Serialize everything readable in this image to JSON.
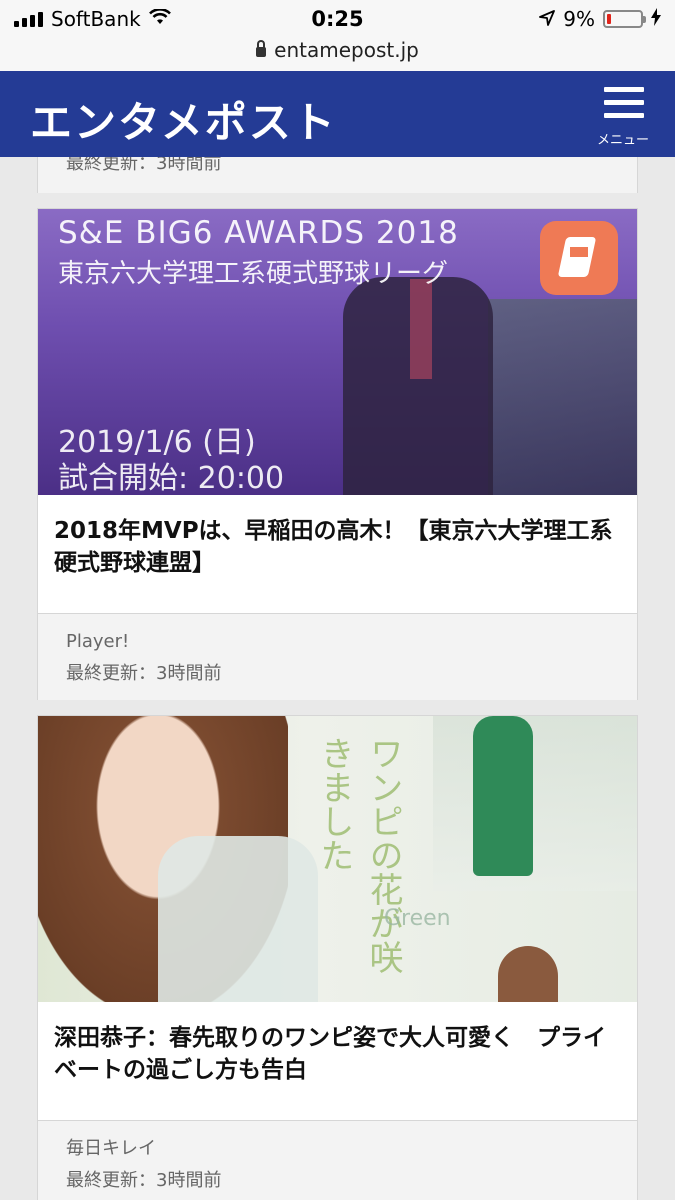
{
  "status_bar": {
    "carrier": "SoftBank",
    "time": "0:25",
    "battery": "9%",
    "battery_level": 0.09
  },
  "browser": {
    "url": "entamepost.jp"
  },
  "header": {
    "logo": "エンタメポスト",
    "menu_label": "メニュー"
  },
  "articles": [
    {
      "meta_updated": "最終更新：3時間前"
    },
    {
      "image_text": {
        "line1": "S&E BIG6 AWARDS 2018",
        "line2": "東京六大学理工系硬式野球リーグ",
        "date": "2019/1/6 (日)",
        "time": "試合開始: 20:00"
      },
      "title": "2018年MVPは、早稲田の高木！【東京六大学理工系硬式野球連盟】",
      "source": "Player!",
      "meta_updated": "最終更新：3時間前"
    },
    {
      "image_text": {
        "word": "Green"
      },
      "title": "深田恭子：春先取りのワンピ姿で大人可愛く　プライベートの過ごし方も告白",
      "source": "毎日キレイ",
      "meta_updated": "最終更新：3時間前"
    }
  ]
}
